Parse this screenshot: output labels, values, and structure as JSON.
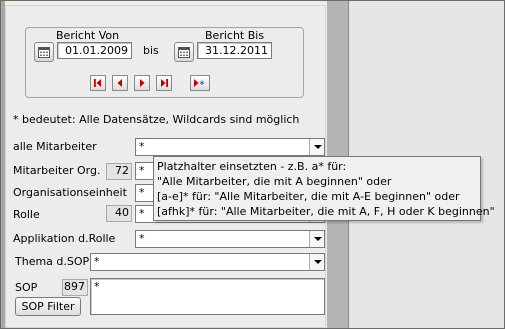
{
  "date_range": {
    "from_label": "Bericht Von",
    "from_value": "01.01.2009",
    "to_label": "Bericht Bis",
    "to_value": "31.12.2011",
    "between": "bis"
  },
  "hint": "* bedeutet: Alle Datensätze, Wildcards sind möglich",
  "fields": {
    "alle_mitarbeiter": {
      "label": "alle Mitarbeiter",
      "value": "*"
    },
    "mitarbeiter_org": {
      "label": "Mitarbeiter Org.",
      "count": "72",
      "value": "*"
    },
    "organisationseinheit": {
      "label": "Organisationseinheit",
      "value": "*"
    },
    "rolle": {
      "label": "Rolle",
      "count": "40",
      "value": "*"
    },
    "applikation": {
      "label": "Applikation d.Rolle",
      "value": "*"
    },
    "thema": {
      "label": "Thema d.SOP",
      "value": "*"
    },
    "sop": {
      "label": "SOP",
      "count": "897",
      "value": "*"
    }
  },
  "sop_filter_button": "SOP Filter",
  "tooltip": {
    "lines": [
      "Platzhalter einsetzten - z.B. a* für:",
      "\"Alle Mitarbeiter, die mit A beginnen\" oder",
      "[a-e]* für: \"Alle Mitarbeiter, die mit A-E beginnen\" oder",
      "[afhk]* für: \"Alle Mitarbeiter, die mit A, F, H oder K beginnen\""
    ]
  },
  "icons": {
    "calendar": "calendar-icon",
    "first": "first-record-icon",
    "prev": "previous-record-icon",
    "next": "next-record-icon",
    "last": "last-record-icon",
    "new": "new-record-icon"
  }
}
